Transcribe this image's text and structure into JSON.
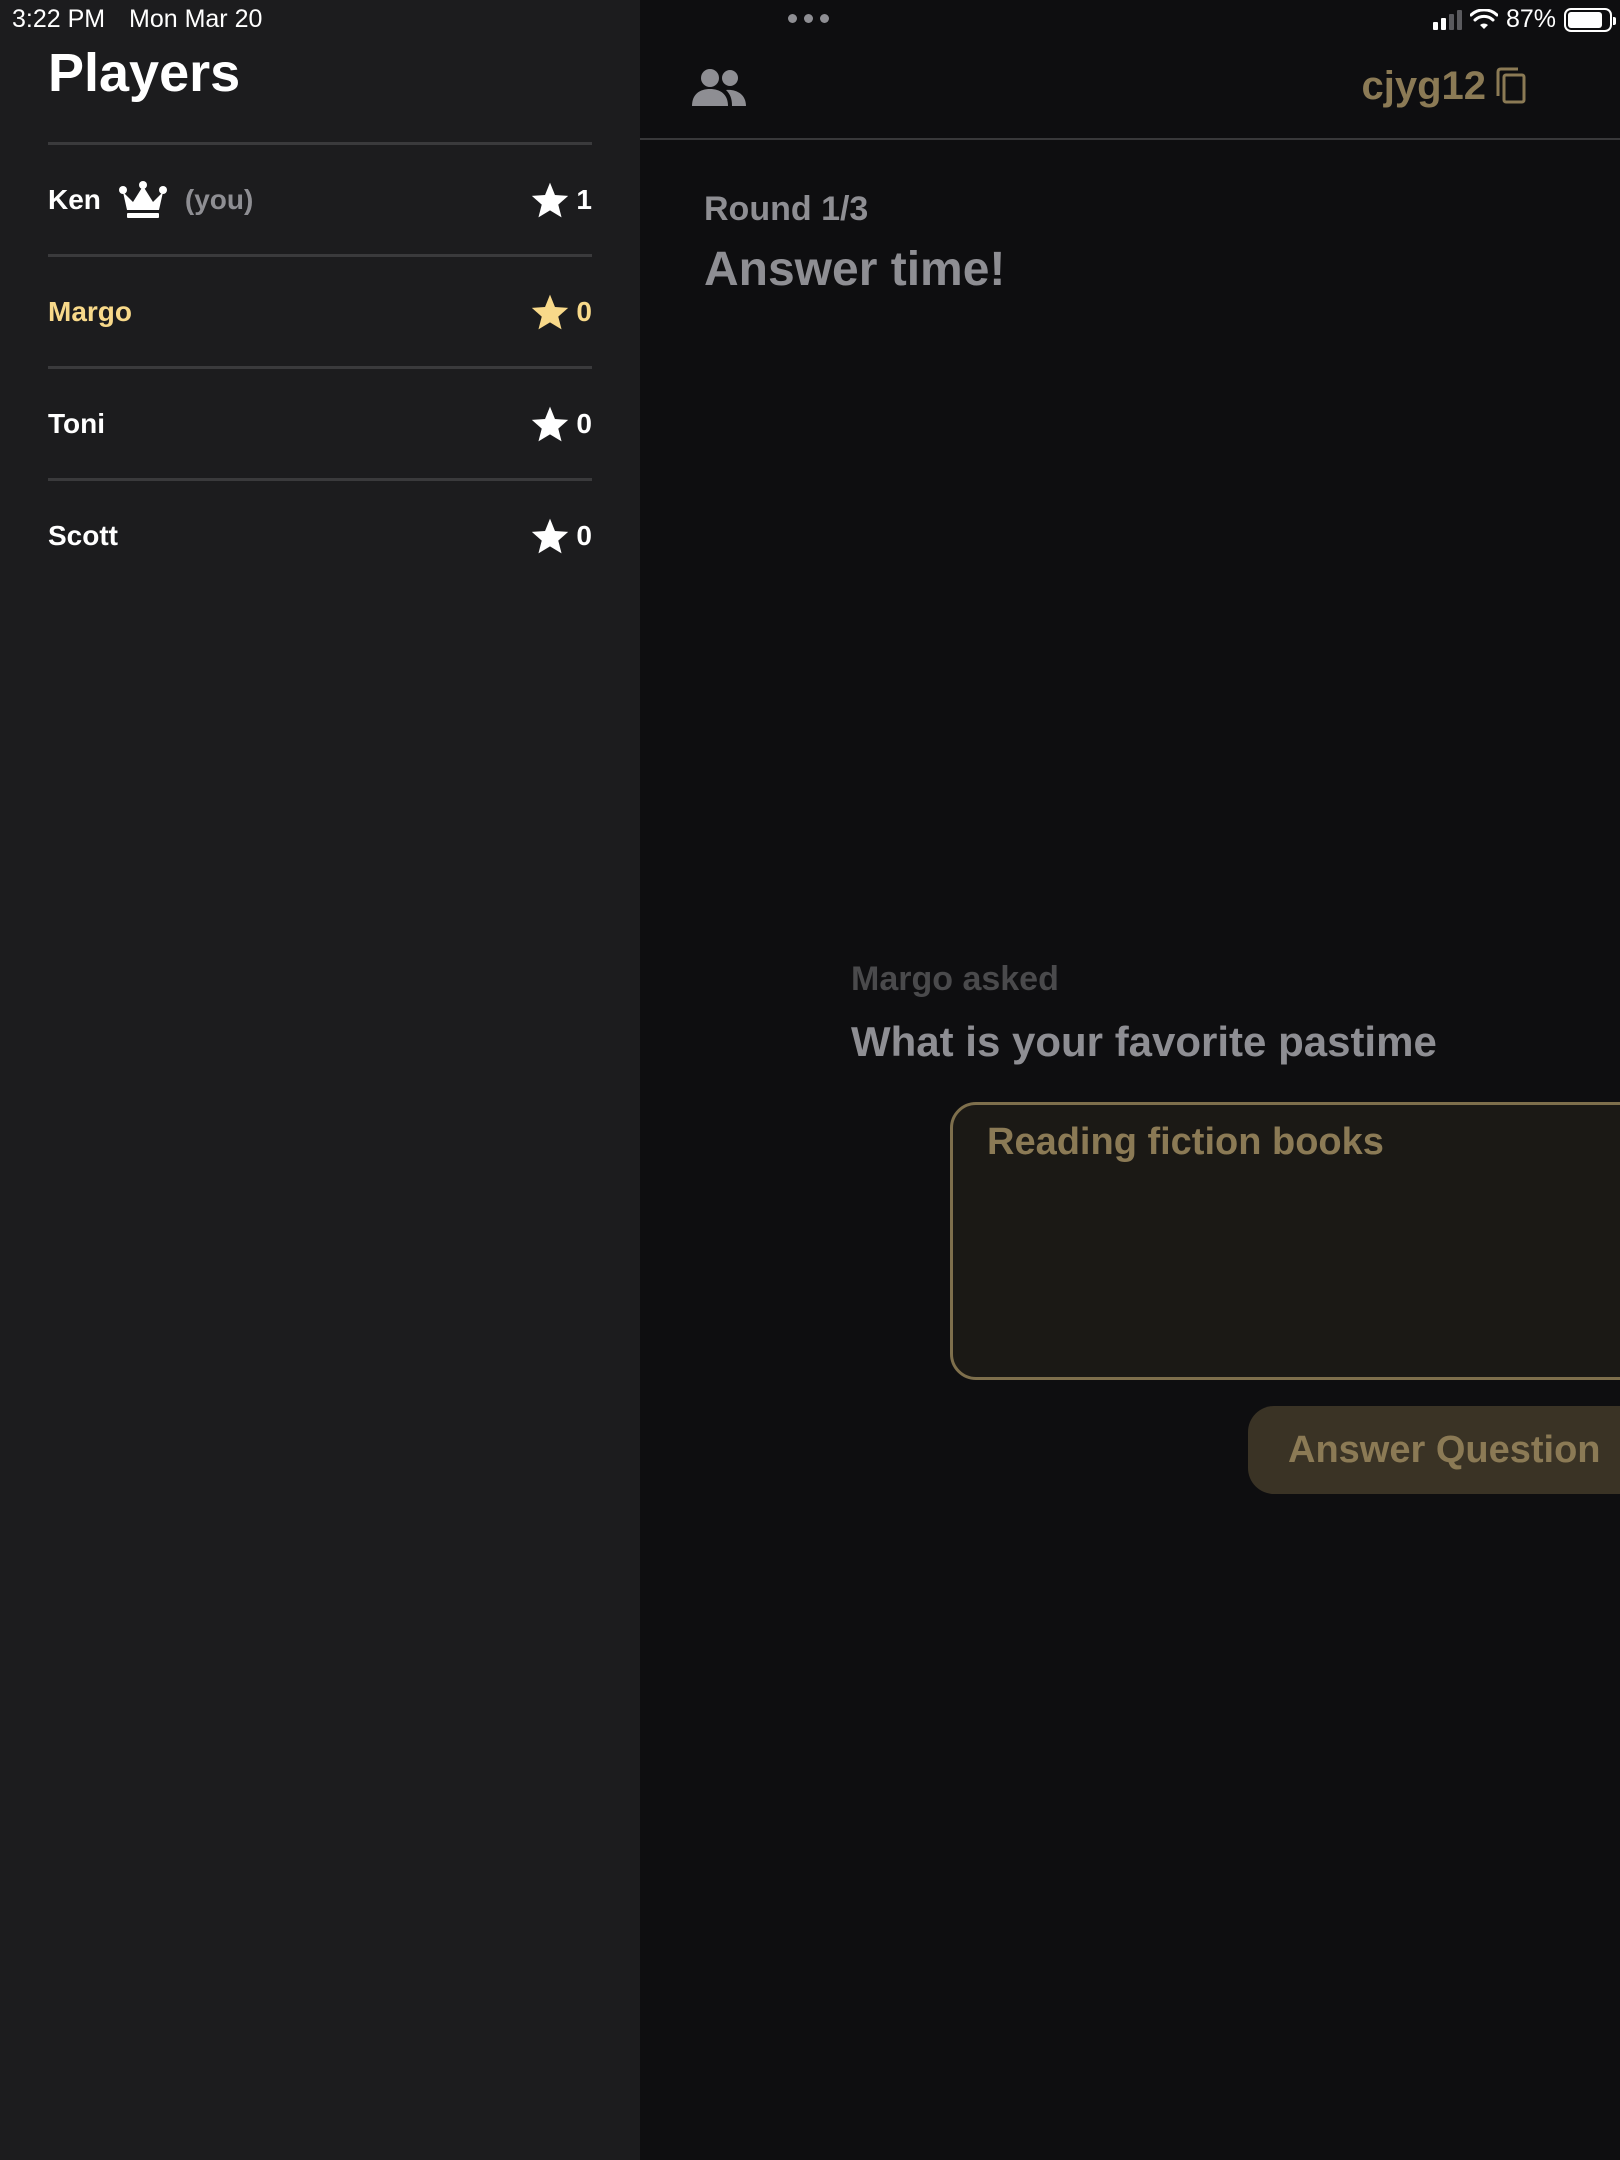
{
  "status_bar": {
    "time": "3:22 PM",
    "date": "Mon Mar 20",
    "battery": "87%"
  },
  "sidebar": {
    "title": "Players",
    "players": [
      {
        "name": "Ken",
        "badge": "crown-icon",
        "you_label": "(you)",
        "score": "1",
        "highlighted": false
      },
      {
        "name": "Margo",
        "score": "0",
        "highlighted": true
      },
      {
        "name": "Toni",
        "score": "0",
        "highlighted": false
      },
      {
        "name": "Scott",
        "score": "0",
        "highlighted": false
      }
    ]
  },
  "main": {
    "room_code": "cjyg12",
    "round_label": "Round 1/3",
    "phase_title": "Answer time!",
    "asker_label": "Margo asked",
    "question": "What is your favorite pastime",
    "answer_value": "Reading fiction books",
    "answer_button": "Answer Question"
  },
  "colors": {
    "sidebar_bg": "#1c1c1e",
    "main_bg": "#0e0e10",
    "highlight": "#f8d98a",
    "accent_muted": "#8b7a55",
    "muted_text": "#8e8e93"
  },
  "icons": [
    "people-icon",
    "copy-icon",
    "crown-icon",
    "star-icon",
    "wifi-icon",
    "signal-icon",
    "battery-icon"
  ]
}
